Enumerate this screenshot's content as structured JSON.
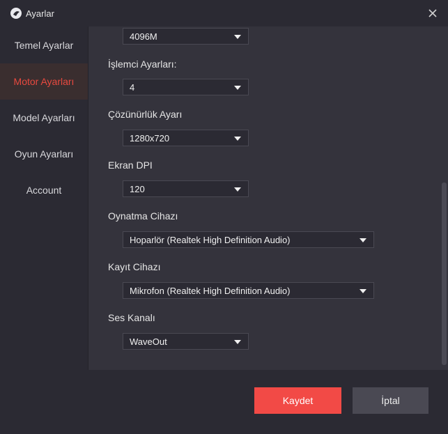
{
  "window": {
    "title": "Ayarlar"
  },
  "sidebar": {
    "items": [
      {
        "label": "Temel Ayarlar"
      },
      {
        "label": "Motor Ayarları",
        "active": true
      },
      {
        "label": "Model Ayarları"
      },
      {
        "label": "Oyun Ayarları"
      },
      {
        "label": "Account"
      }
    ]
  },
  "settings": {
    "memory": {
      "value": "4096M"
    },
    "cpu": {
      "label": "İşlemci Ayarları:",
      "value": "4"
    },
    "resolution": {
      "label": "Çözünürlük Ayarı",
      "value": "1280x720"
    },
    "dpi": {
      "label": "Ekran DPI",
      "value": "120"
    },
    "playback": {
      "label": "Oynatma Cihazı",
      "value": "Hoparlör (Realtek High Definition Audio)"
    },
    "recording": {
      "label": "Kayıt Cihazı",
      "value": "Mikrofon (Realtek High Definition Audio)"
    },
    "sound_channel": {
      "label": "Ses Kanalı",
      "value": "WaveOut"
    }
  },
  "footer": {
    "save_label": "Kaydet",
    "cancel_label": "İptal"
  },
  "colors": {
    "accent": "#f24a46",
    "active_text": "#e8493f",
    "background": "#2b2a33",
    "panel": "#34333c"
  }
}
